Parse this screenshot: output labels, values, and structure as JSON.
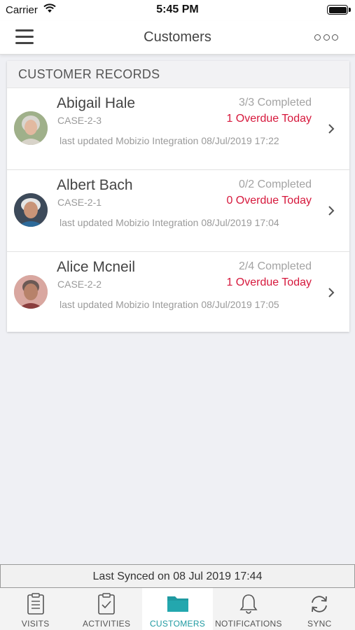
{
  "status_bar": {
    "carrier": "Carrier",
    "time": "5:45 PM"
  },
  "nav": {
    "title": "Customers"
  },
  "section": {
    "title": "CUSTOMER RECORDS"
  },
  "customers": [
    {
      "name": "Abigail Hale",
      "case": "CASE-2-3",
      "completed": "3/3 Completed",
      "overdue": "1 Overdue Today",
      "updated": "last updated Mobizio Integration 08/Jul/2019 17:22"
    },
    {
      "name": "Albert Bach",
      "case": "CASE-2-1",
      "completed": "0/2 Completed",
      "overdue": "0 Overdue Today",
      "updated": "last updated Mobizio Integration 08/Jul/2019 17:04"
    },
    {
      "name": "Alice Mcneil",
      "case": "CASE-2-2",
      "completed": "2/4 Completed",
      "overdue": "1 Overdue Today",
      "updated": "last updated Mobizio Integration 08/Jul/2019 17:05"
    }
  ],
  "sync": {
    "text": "Last Synced on 08 Jul 2019 17:44"
  },
  "tabs": [
    {
      "label": "VISITS",
      "icon": "clipboard-list-icon",
      "active": false
    },
    {
      "label": "ACTIVITIES",
      "icon": "clipboard-check-icon",
      "active": false
    },
    {
      "label": "CUSTOMERS",
      "icon": "folder-icon",
      "active": true
    },
    {
      "label": "NOTIFICATIONS",
      "icon": "bell-icon",
      "active": false
    },
    {
      "label": "SYNC",
      "icon": "sync-icon",
      "active": false
    }
  ],
  "colors": {
    "accent": "#1f9aa1",
    "overdue": "#d6183c"
  }
}
